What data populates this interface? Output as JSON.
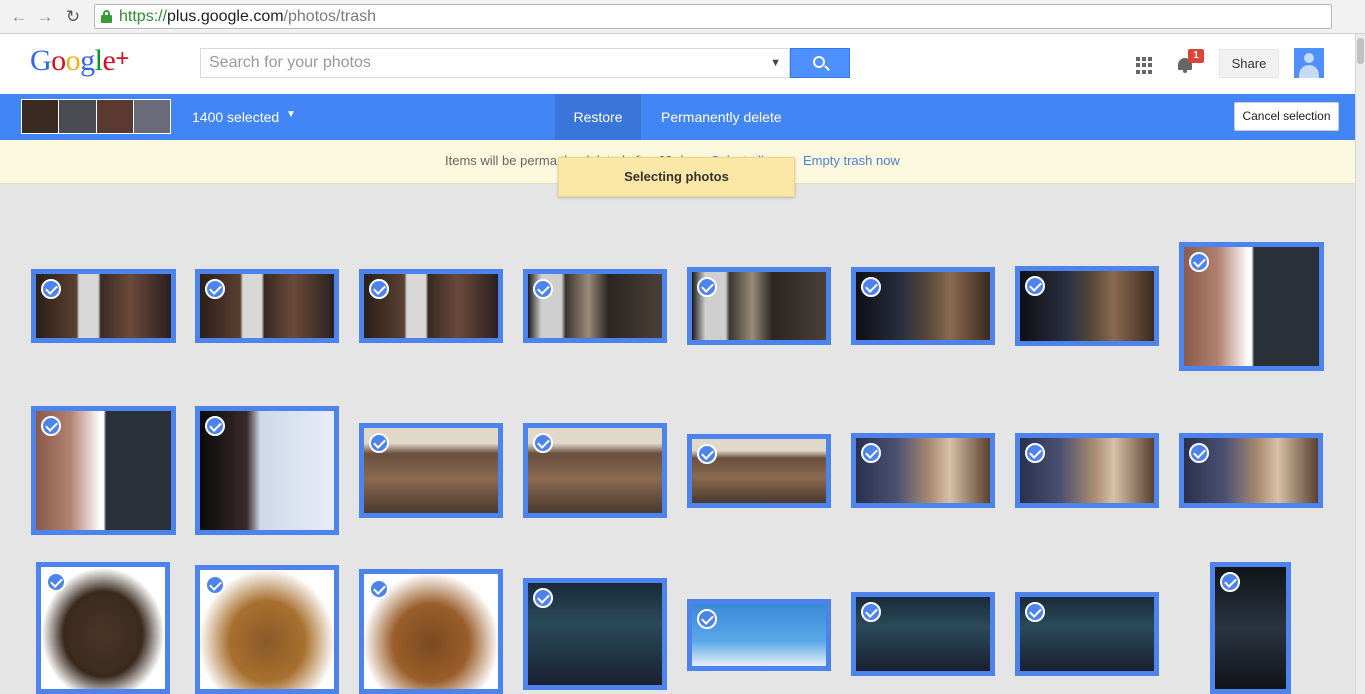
{
  "browser": {
    "url_scheme": "https://",
    "url_host": "plus.google.com",
    "url_path": "/photos/trash",
    "back_icon": "←",
    "forward_icon": "→",
    "reload_icon": "↻",
    "star_icon": "☆"
  },
  "header": {
    "logo": {
      "G": "G",
      "o1": "o",
      "o2": "o",
      "g": "g",
      "l": "l",
      "e": "e",
      "plus": "+"
    },
    "search_placeholder": "Search for your photos",
    "share_label": "Share",
    "notification_count": "1"
  },
  "selection_bar": {
    "count_label": "1400 selected",
    "caret": "▼",
    "restore_label": "Restore",
    "delete_label": "Permanently delete",
    "cancel_label": "Cancel selection"
  },
  "notice": {
    "text": "Items will be perma",
    "text_cont": "    the   deleted after 60 days.",
    "link_partial": "Select all",
    "empty_trash_label": "Empty trash now",
    "toast": "Selecting photos"
  },
  "colors": {
    "brand_blue": "#4285f4",
    "selection_border": "#4d83ec",
    "notice_bg": "#fcf8dd"
  },
  "photos": [
    {
      "kind": "dark-movie",
      "selected": true
    },
    {
      "kind": "dark-movie",
      "selected": true
    },
    {
      "kind": "dark-movie",
      "selected": true
    },
    {
      "kind": "dark-curtain",
      "selected": true
    },
    {
      "kind": "dark-curtain",
      "selected": true
    },
    {
      "kind": "dark-portrait",
      "selected": true
    },
    {
      "kind": "dark-portrait",
      "selected": true
    },
    {
      "kind": "phone-screenshot",
      "selected": true
    },
    {
      "kind": "phone-screenshot",
      "selected": true
    },
    {
      "kind": "phone-chat",
      "selected": true
    },
    {
      "kind": "family-photo",
      "selected": true
    },
    {
      "kind": "family-photo",
      "selected": true
    },
    {
      "kind": "family-photo",
      "selected": true
    },
    {
      "kind": "editor-portrait",
      "selected": true
    },
    {
      "kind": "editor-portrait",
      "selected": true
    },
    {
      "kind": "editor-portrait",
      "selected": true
    },
    {
      "kind": "leather-bag",
      "selected": true
    },
    {
      "kind": "tablet-case",
      "selected": true
    },
    {
      "kind": "wallet-case",
      "selected": true
    },
    {
      "kind": "app-screen",
      "selected": true
    },
    {
      "kind": "cleaner-banner",
      "selected": true
    },
    {
      "kind": "app-screen",
      "selected": true
    },
    {
      "kind": "app-screen",
      "selected": true
    },
    {
      "kind": "phone-settings",
      "selected": true
    }
  ]
}
